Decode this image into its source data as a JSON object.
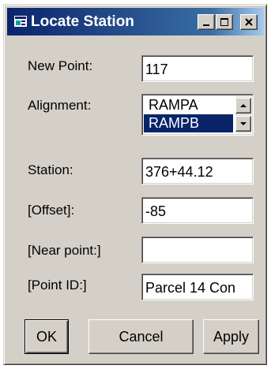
{
  "window": {
    "title": "Locate Station",
    "icon": "station-app-icon",
    "controls": [
      "minimize-icon",
      "maximize-icon",
      "close-icon"
    ]
  },
  "form": {
    "new_point": {
      "label": "New Point:",
      "value": "117"
    },
    "alignment": {
      "label": "Alignment:",
      "options": [
        "RAMPA",
        "RAMPB"
      ],
      "selected": "RAMPB"
    },
    "station": {
      "label": "Station:",
      "value": "376+44.12"
    },
    "offset": {
      "label": "[Offset]:",
      "value": "-85"
    },
    "near_point": {
      "label": "[Near point:]",
      "value": ""
    },
    "point_id": {
      "label": "[Point ID:]",
      "value": "Parcel 14 Con"
    }
  },
  "buttons": {
    "ok": "OK",
    "cancel": "Cancel",
    "apply": "Apply"
  },
  "colors": {
    "title_bar": "#0a246a",
    "selection": "#0a246a",
    "dialog_face": "#d4d0c8"
  }
}
